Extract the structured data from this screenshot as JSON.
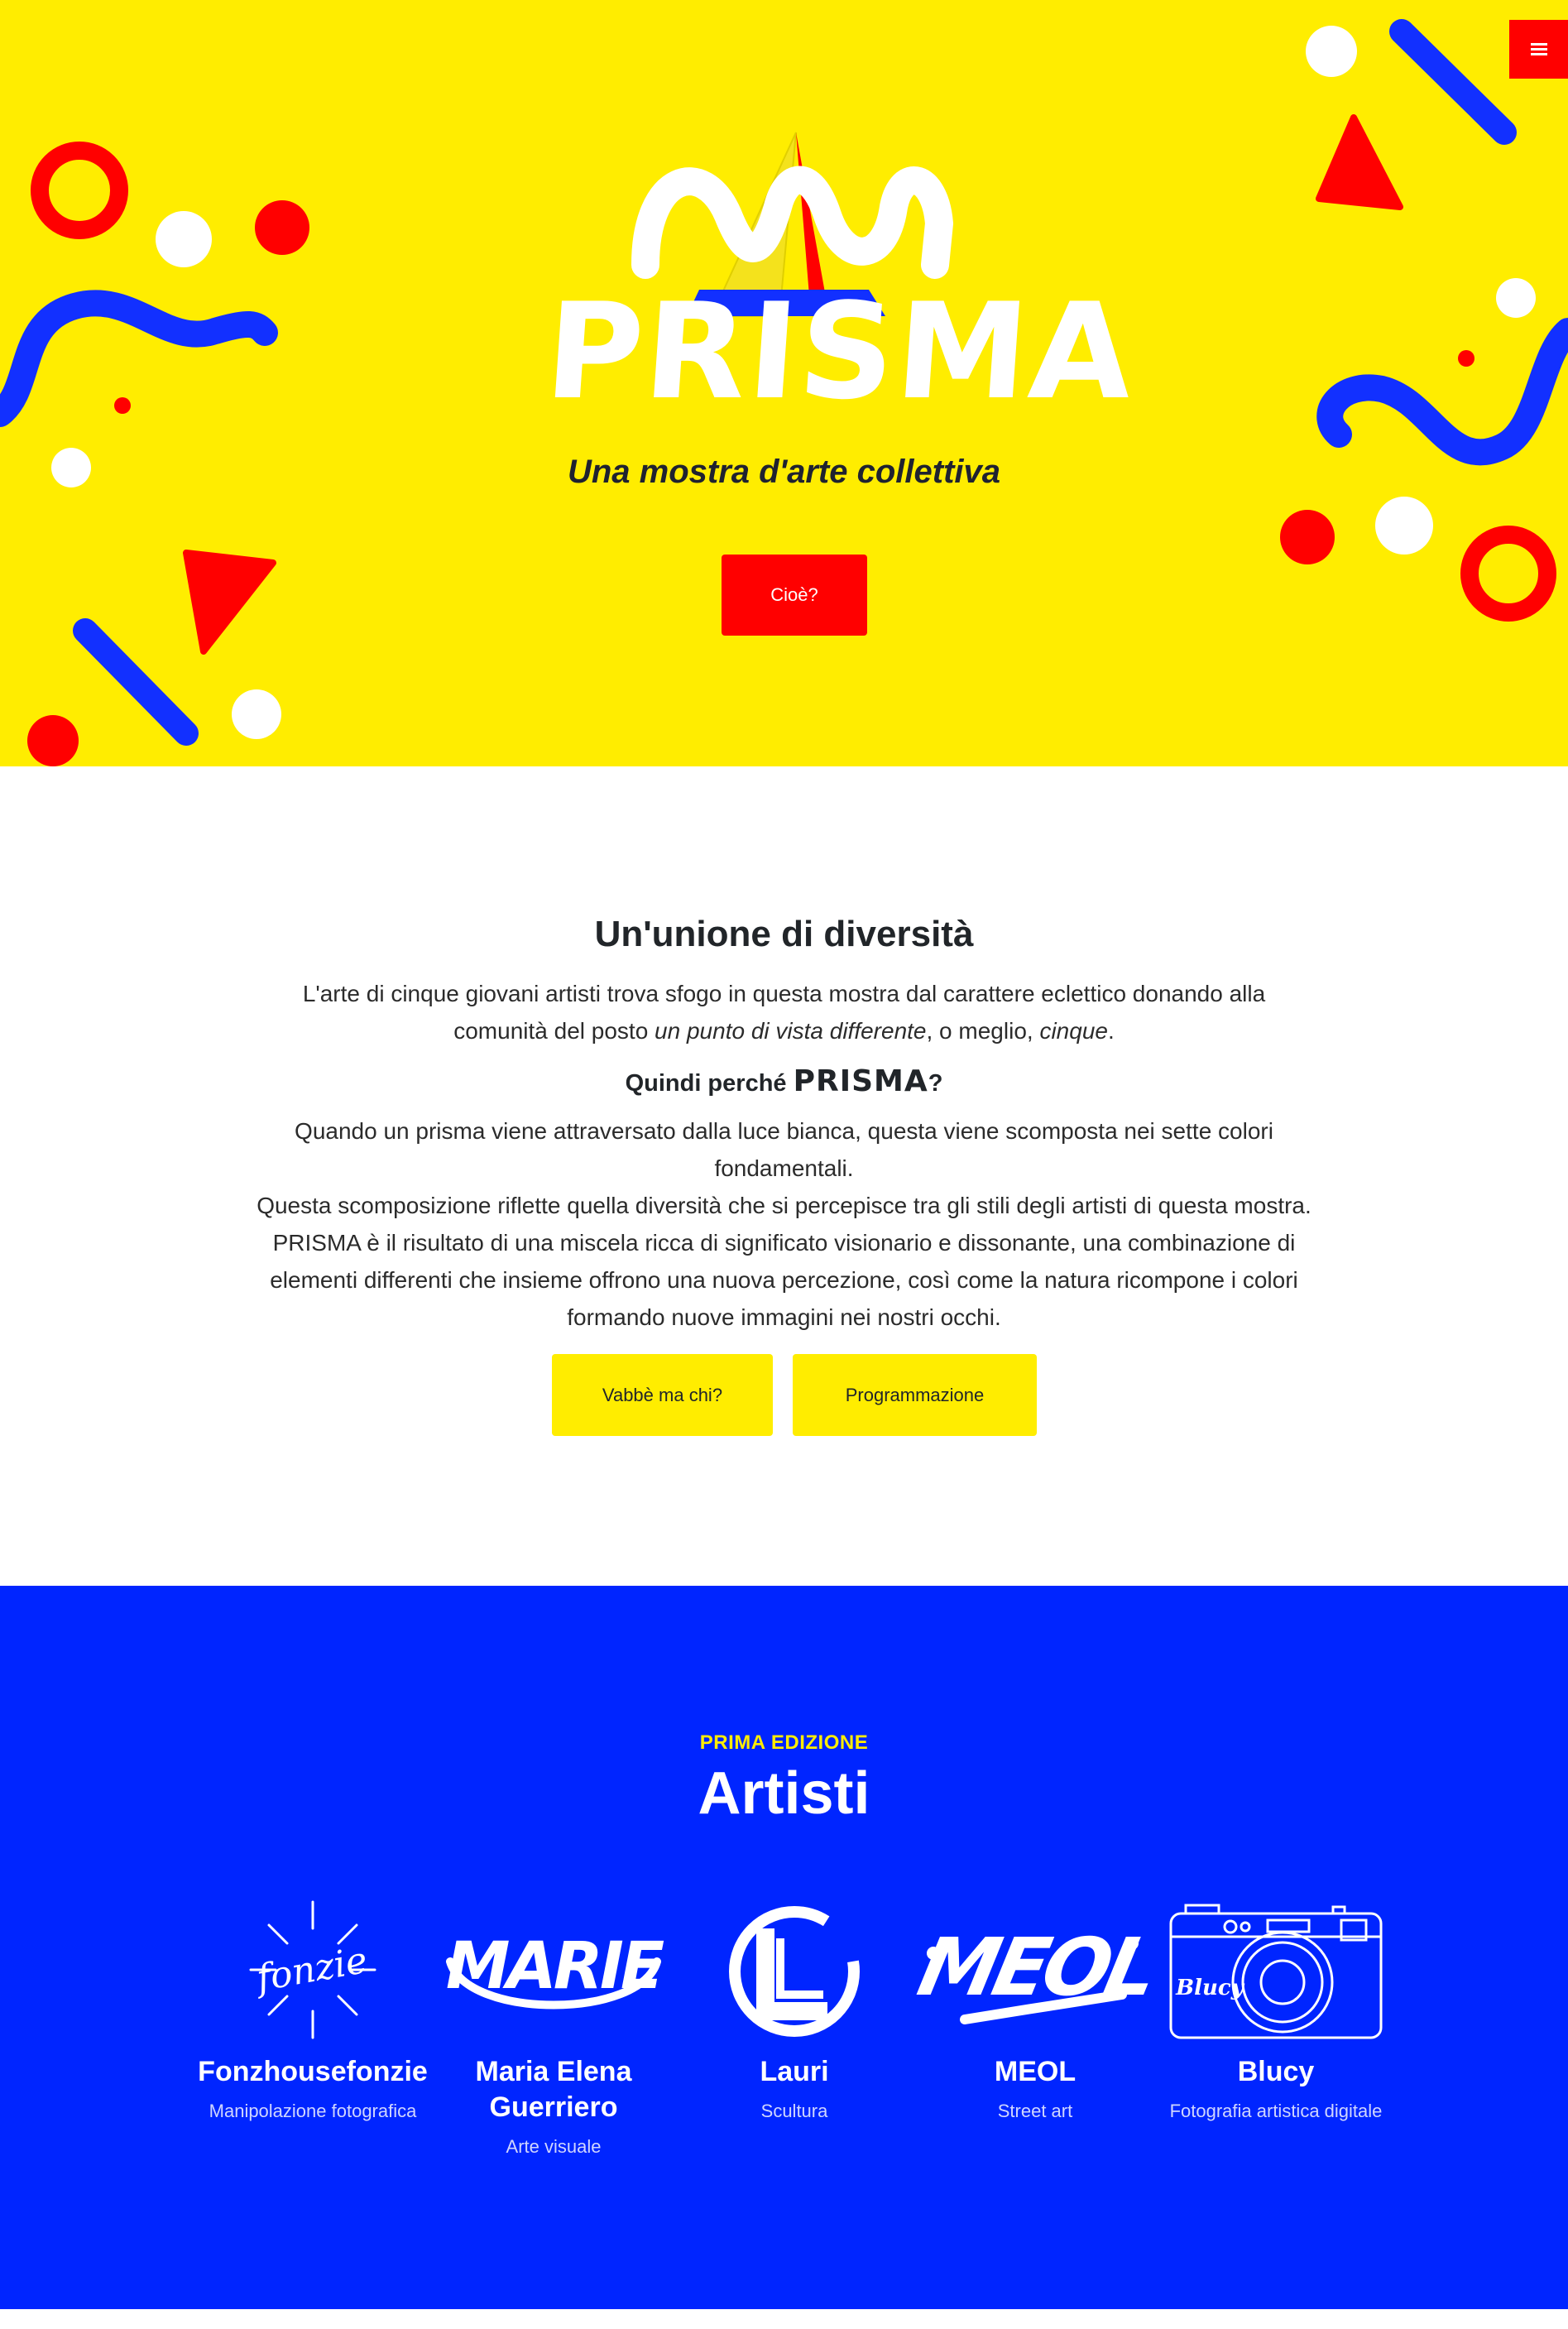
{
  "colors": {
    "yellow": "#ffed00",
    "red": "#ff0000",
    "blue": "#0025ff",
    "white": "#ffffff",
    "dark": "#212529"
  },
  "hero": {
    "menu_icon": "hamburger-icon",
    "brand": "PRISMA",
    "tagline": "Una mostra d'arte collettiva",
    "cta_label": "Cioè?"
  },
  "about": {
    "title": "Un'unione di diversità",
    "intro_pre": "L'arte di cinque giovani artisti trova sfogo in questa mostra dal carattere eclettico donando alla comunità del posto ",
    "intro_em1": "un punto di vista differente",
    "intro_mid": ", o meglio, ",
    "intro_em2": "cinque",
    "intro_post": ".",
    "why_pre": "Quindi perché ",
    "why_word": "PRISMA",
    "why_post": "?",
    "p2_line1": "Quando un prisma viene attraversato dalla luce bianca, questa viene scomposta nei sette colori fondamentali.",
    "p2_line2": "Questa scomposizione riflette quella diversità che si percepisce tra gli stili degli artisti di questa mostra.",
    "p2_line3": "PRISMA è il risultato di una miscela ricca di significato visionario e dissonante, una combinazione di elementi differenti che insieme offrono una nuova percezione, così come la natura ricompone i colori formando nuove immagini nei nostri occhi.",
    "btn_who": "Vabbè ma chi?",
    "btn_prog": "Programmazione"
  },
  "artists": {
    "eyebrow": "PRIMA EDIZIONE",
    "title": "Artisti",
    "items": [
      {
        "name": "Fonzhousefonzie",
        "role": "Manipolazione fotografica",
        "logo_text": "fonzie",
        "icon": "sun-signature-logo"
      },
      {
        "name": "Maria Elena Guerriero",
        "role": "Arte visuale",
        "logo_text": "MARIE",
        "icon": "marie-logo"
      },
      {
        "name": "Lauri",
        "role": "Scultura",
        "logo_text": "L",
        "icon": "circle-l-logo"
      },
      {
        "name": "MEOL",
        "role": "Street art",
        "logo_text": "MEOL",
        "icon": "meol-tag-logo"
      },
      {
        "name": "Blucy",
        "role": "Fotografia artistica digitale",
        "logo_text": "Blucy",
        "icon": "camera-logo"
      }
    ]
  }
}
